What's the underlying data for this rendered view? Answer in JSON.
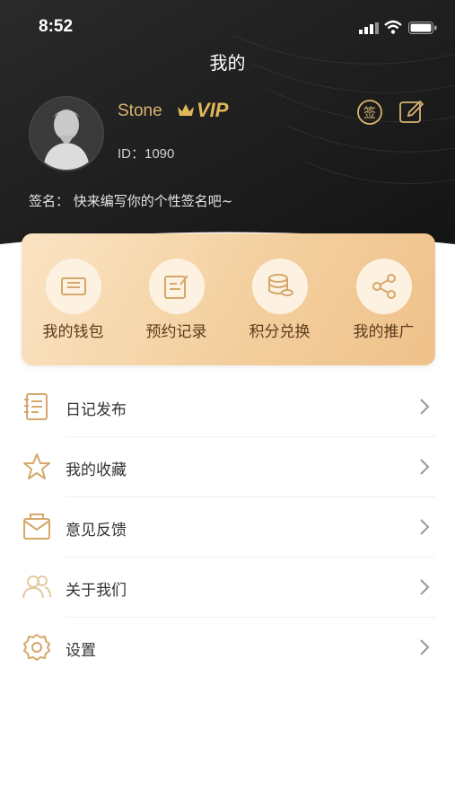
{
  "status": {
    "time": "8:52"
  },
  "header": {
    "title": "我的"
  },
  "profile": {
    "name": "Stone",
    "vip": "VIP",
    "id": "ID：1090",
    "signature": "签名： 快来编写你的个性签名吧~",
    "sign_icon_text": "签"
  },
  "quick": [
    {
      "label": "我的钱包",
      "icon": "wallet-icon"
    },
    {
      "label": "预约记录",
      "icon": "appointment-icon"
    },
    {
      "label": "积分兑换",
      "icon": "points-icon"
    },
    {
      "label": "我的推广",
      "icon": "share-icon"
    }
  ],
  "menu": [
    {
      "label": "日记发布",
      "icon": "diary-icon"
    },
    {
      "label": "我的收藏",
      "icon": "star-icon"
    },
    {
      "label": "意见反馈",
      "icon": "feedback-icon"
    },
    {
      "label": "关于我们",
      "icon": "about-icon"
    },
    {
      "label": "设置",
      "icon": "settings-icon"
    }
  ],
  "colors": {
    "gold": "#d8b46f",
    "card_text": "#5b3b1c",
    "hero_bg": "#1c1c1c"
  }
}
